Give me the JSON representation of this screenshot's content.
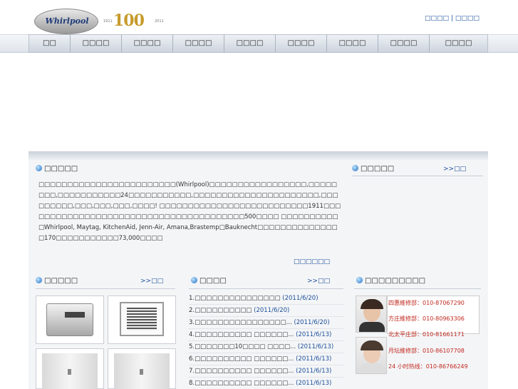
{
  "header": {
    "logo_text": "Whirlpool",
    "anniversary_number": "100",
    "anniversary_start": "1911",
    "anniversary_end": "2011",
    "top_link_1": "□□□□",
    "top_link_sep": "|",
    "top_link_2": "□□□□"
  },
  "nav": {
    "items": [
      "□□",
      "□□□□",
      "□□□□",
      "□□□□",
      "□□□□",
      "□□□□",
      "□□□□",
      "□□□□",
      "□□□□"
    ]
  },
  "about": {
    "title": "□□□□□",
    "text": "□□□□□□□□□□□□□□□□□□□□□□□□(Whirlpool)□□□□□□□□□□□□□□□□□,□□□□□□□□,□□□□□□□□□□□24□□□□□□□□□□□,□□□□□□□□□□□□□□□□□□□□□□,□□□□□□□□□,□□□,□□□,□□□,□□□□! □□□□□□□□□□□□□□□□□□□□□□□□□□1911□□□□□□□□□□□□□□□□□□□□□□□□□□□□□□□□□□□□□□□500□□□□ □□□□□□□□□□□Whirlpool, Maytag, KitchenAid, Jenn-Air, Amana,Brastemp□Bauknecht□□□□□□□□□□□□□□□170□□□□□□□□□□□73,000□□□□",
    "more": "□□□□□□"
  },
  "notice": {
    "title": "□□□□□",
    "more": ">>□□"
  },
  "products": {
    "title": "□□□□□",
    "more": ">>□□"
  },
  "news": {
    "title": "□□□□",
    "more": ">>□□",
    "items": [
      {
        "n": "1.",
        "text": "□□□□□□□□□□□□□□□",
        "date": "(2011/6/20)"
      },
      {
        "n": "2.",
        "text": "□□□□□□□□□□",
        "date": "(2011/6/20)"
      },
      {
        "n": "3.",
        "text": "□□□□□□□□□□□□□□□□...",
        "date": "(2011/6/20)"
      },
      {
        "n": "4.",
        "text": "□□□□□□□□□□ □□□□□□...",
        "date": "(2011/6/13)"
      },
      {
        "n": "5.",
        "text": "□□□□□□□10□□□□ □□□□...",
        "date": "(2011/6/13)"
      },
      {
        "n": "6.",
        "text": "□□□□□□□□□□ □□□□□□...",
        "date": "(2011/6/13)"
      },
      {
        "n": "7.",
        "text": "□□□□□□□□□□ □□□□□□...",
        "date": "(2011/6/13)"
      },
      {
        "n": "8.",
        "text": "□□□□□□□□□□ □□□□□□...",
        "date": "(2011/6/13)"
      }
    ]
  },
  "service": {
    "title": "□□□□□□□□□",
    "lines": [
      "四惠維修部：010-87067290",
      "方庄維修部：010-80963306",
      "北太平庄部：010-81661171",
      "月坛維修部：010-86107708",
      "24 小时热线：010-86766249"
    ]
  },
  "colors": {
    "link": "#1a4f9a",
    "service_red": "#c0281e",
    "gold": "#c79a2a"
  }
}
